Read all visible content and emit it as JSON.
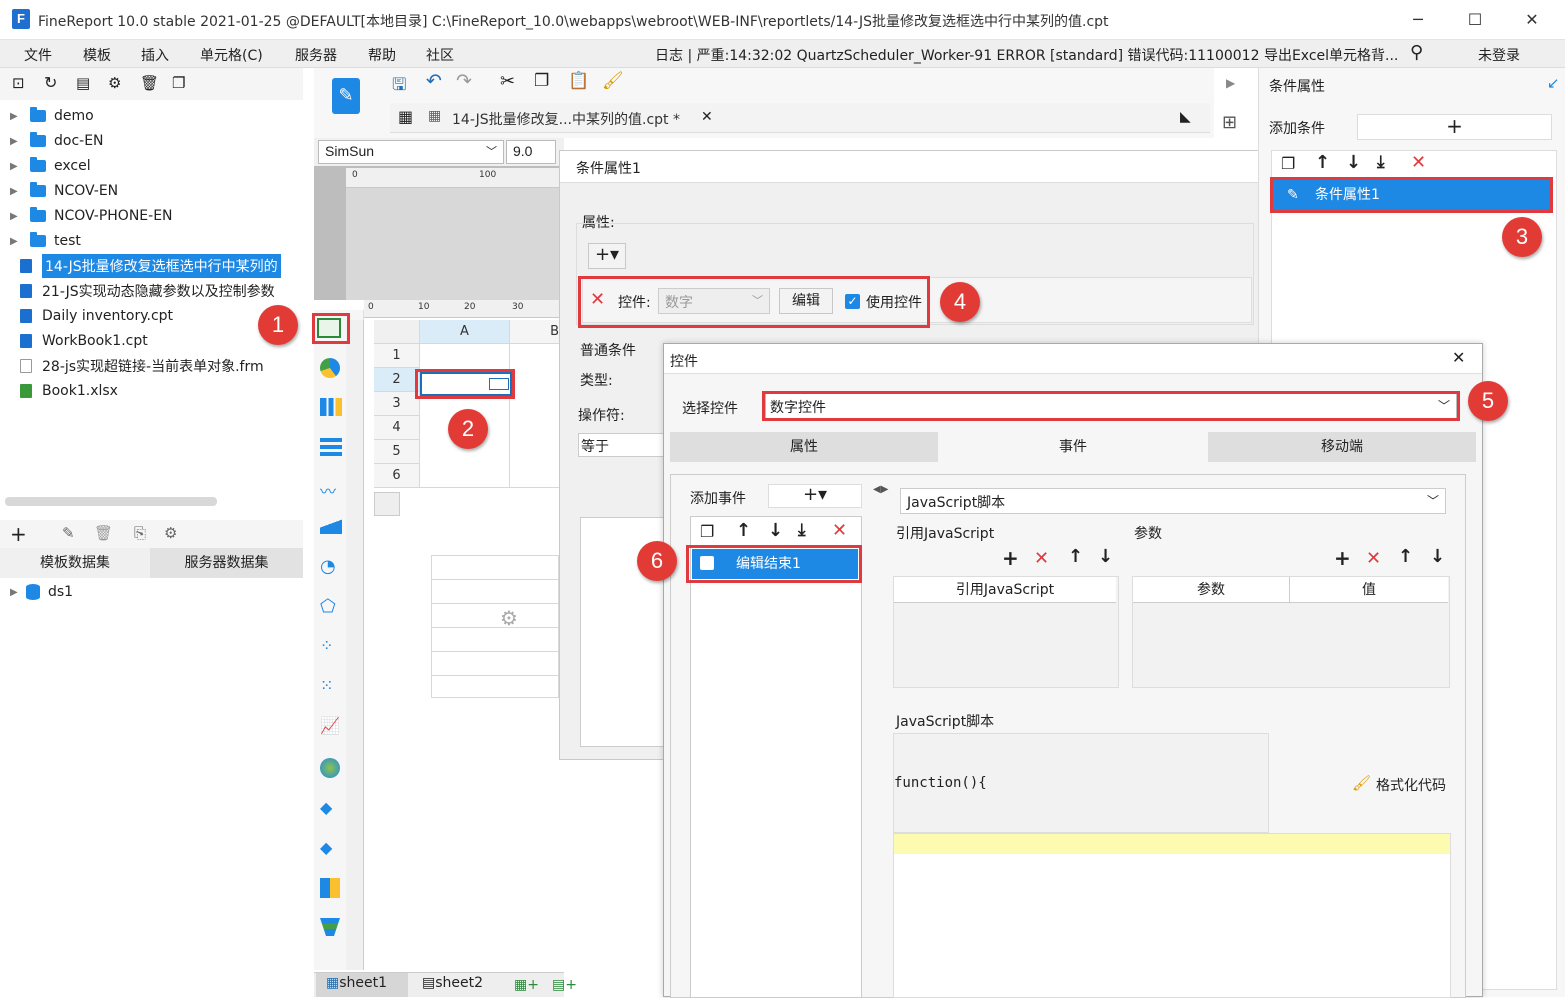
{
  "window": {
    "title": "FineReport 10.0 stable 2021-01-25 @DEFAULT[本地目录]    C:\\FineReport_10.0\\webapps\\webroot\\WEB-INF\\reportlets/14-JS批量修改复选框选中行中某列的值.cpt",
    "minimize": "─",
    "maximize": "☐",
    "close": "✕"
  },
  "menu": {
    "items": [
      "文件",
      "模板",
      "插入",
      "单元格(C)",
      "服务器",
      "帮助",
      "社区"
    ],
    "log": "日志 | 严重:14:32:02 QuartzScheduler_Worker-91 ERROR [standard] 错误代码:11100012 导出Excel单元格背...",
    "login": "未登录"
  },
  "tree": {
    "items": [
      {
        "label": "demo",
        "type": "folder"
      },
      {
        "label": "doc-EN",
        "type": "folder"
      },
      {
        "label": "excel",
        "type": "folder"
      },
      {
        "label": "NCOV-EN",
        "type": "folder"
      },
      {
        "label": "NCOV-PHONE-EN",
        "type": "folder"
      },
      {
        "label": "test",
        "type": "folder"
      },
      {
        "label": "14-JS批量修改复选框选中行中某列的",
        "type": "file",
        "selected": true
      },
      {
        "label": "21-JS实现动态隐藏参数以及控制参数",
        "type": "file"
      },
      {
        "label": "Daily inventory.cpt",
        "type": "file"
      },
      {
        "label": "WorkBook1.cpt",
        "type": "file"
      },
      {
        "label": "28-js实现超链接-当前表单对象.frm",
        "type": "file"
      },
      {
        "label": "Book1.xlsx",
        "type": "excel"
      }
    ]
  },
  "dataset": {
    "tabs": [
      "模板数据集",
      "服务器数据集"
    ],
    "items": [
      "ds1"
    ]
  },
  "editor": {
    "tab": "14-JS批量修改复...中某列的值.cpt *",
    "font": "SimSun",
    "size": "9.0",
    "col": "A",
    "col2": "B",
    "rows": [
      "1",
      "2",
      "3",
      "4",
      "5",
      "6"
    ],
    "sheets": [
      "sheet1",
      "sheet2"
    ],
    "ruler_top": [
      "0",
      "100"
    ],
    "ruler_grid": [
      "0",
      "10",
      "20",
      "30"
    ]
  },
  "dialog1": {
    "title": "条件属性1",
    "attr_label": "属性:",
    "control_label": "控件:",
    "control_value": "数字",
    "edit_button": "编辑",
    "use_control": "使用控件",
    "normal_condition": "普通条件",
    "type_label": "类型:",
    "operator_label": "操作符:",
    "operator_value": "等于"
  },
  "right_panel": {
    "title": "条件属性",
    "add_condition": "添加条件",
    "condition_item": "条件属性1"
  },
  "dialog2": {
    "title": "控件",
    "select_label": "选择控件",
    "select_value": "数字控件",
    "tabs": [
      "属性",
      "事件",
      "移动端"
    ],
    "add_event": "添加事件",
    "event_item": "编辑结束1",
    "script_type": "JavaScript脚本",
    "ref_js": "引用JavaScript",
    "params": "参数",
    "ref_js_col": "引用JavaScript",
    "params_col": "参数",
    "value_col": "值",
    "js_script": "JavaScript脚本",
    "code": "function(){",
    "format_code": "格式化代码"
  },
  "badges": [
    "1",
    "2",
    "3",
    "4",
    "5",
    "6"
  ],
  "colors": {
    "accent": "#1e88e5",
    "annotation": "#e0393e"
  }
}
